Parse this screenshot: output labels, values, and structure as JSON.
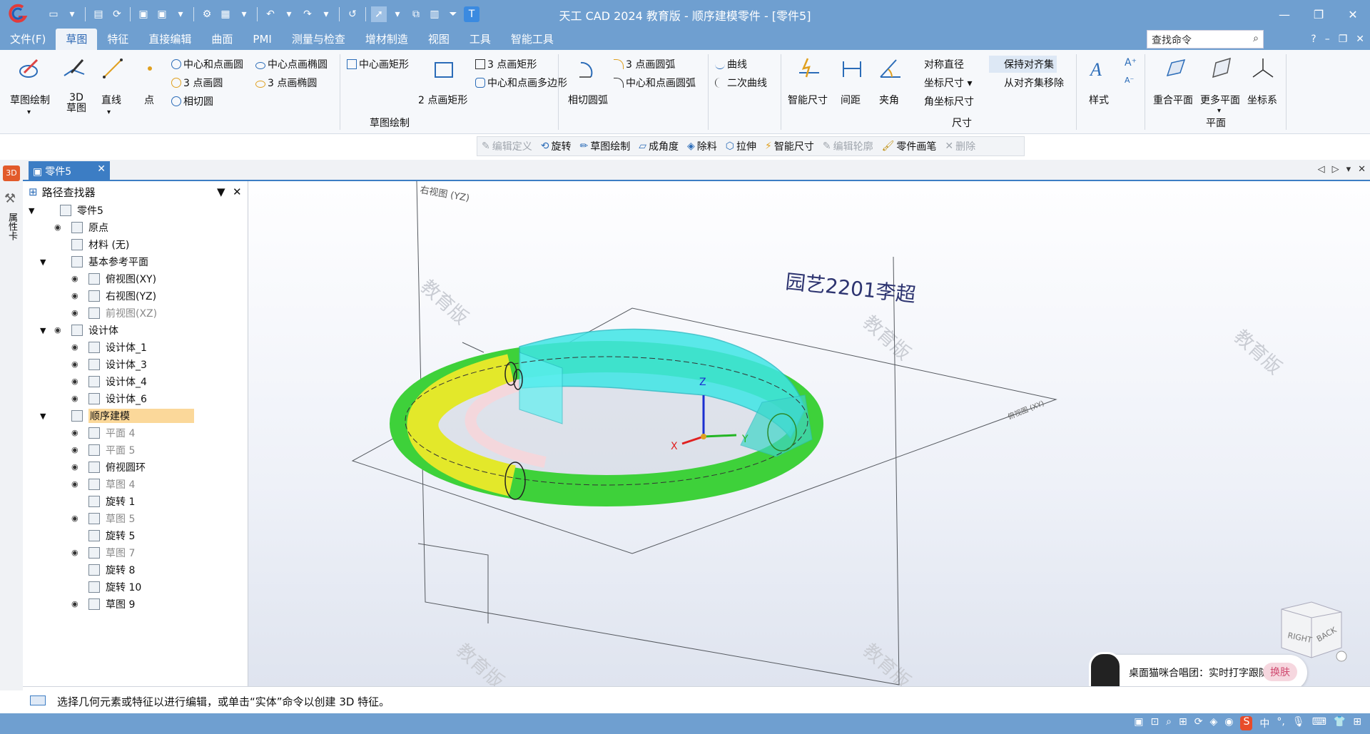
{
  "window": {
    "title": "天工 CAD 2024 教育版 - 顺序建模零件 - [零件5]"
  },
  "menubar": {
    "items": [
      "文件(F)",
      "草图",
      "特征",
      "直接编辑",
      "曲面",
      "PMI",
      "测量与检查",
      "增材制造",
      "视图",
      "工具",
      "智能工具"
    ],
    "search_placeholder": "查找命令"
  },
  "ribbon": {
    "sketch_draw": "草图绘制",
    "sketch_3d": "3D\n草图",
    "line": "直线",
    "point": "点",
    "circle_center": "中心和点画圆",
    "circle_3pt": "3 点画圆",
    "circle_tangent": "相切圆",
    "ellipse_center": "中心点画椭圆",
    "ellipse_3pt": "3 点画椭圆",
    "rect_center": "中心画矩形",
    "rect_2pt": "2 点画矩形",
    "rect_3pt": "3 点画矩形",
    "polygon": "中心和点画多边形",
    "tangent_arc": "相切圆弧",
    "arc_3pt": "3 点画圆弧",
    "arc_center": "中心和点画圆弧",
    "curve": "曲线",
    "conic": "二次曲线",
    "group_sketch": "草图绘制",
    "smart_dim": "智能尺寸",
    "spacing": "间距",
    "angle": "夹角",
    "sym_diameter": "对称直径",
    "coord_dim": "坐标尺寸",
    "angle_coord": "角坐标尺寸",
    "keep_align": "保持对齐集",
    "remove_align": "从对齐集移除",
    "group_dim": "尺寸",
    "style": "样式",
    "coincident_plane": "重合平面",
    "more_planes": "更多平面",
    "coord_sys": "坐标系",
    "group_plane": "平面"
  },
  "featurebar": {
    "items": [
      {
        "label": "编辑定义",
        "disabled": true
      },
      {
        "label": "旋转",
        "disabled": false
      },
      {
        "label": "草图绘制",
        "disabled": false
      },
      {
        "label": "成角度",
        "disabled": false
      },
      {
        "label": "除料",
        "disabled": false
      },
      {
        "label": "拉伸",
        "disabled": false
      },
      {
        "label": "智能尺寸",
        "disabled": false
      },
      {
        "label": "编辑轮廓",
        "disabled": true
      },
      {
        "label": "零件画笔",
        "disabled": false
      },
      {
        "label": "删除",
        "disabled": true
      }
    ]
  },
  "lefticons": {
    "badge": "3D",
    "props": "属性卡"
  },
  "tab": {
    "label": "零件5"
  },
  "pathfinder": {
    "title": "路径查找器",
    "rows": [
      {
        "label": "零件5",
        "level": 0,
        "expand": true,
        "eye": false,
        "gray": false
      },
      {
        "label": "原点",
        "level": 1,
        "expand": false,
        "eye": true,
        "gray": false
      },
      {
        "label": "材料 (无)",
        "level": 1,
        "expand": false,
        "eye": false,
        "gray": false
      },
      {
        "label": "基本参考平面",
        "level": 1,
        "expand": true,
        "eye": false,
        "gray": false
      },
      {
        "label": "俯视图(XY)",
        "level": 2,
        "expand": false,
        "eye": true,
        "gray": false
      },
      {
        "label": "右视图(YZ)",
        "level": 2,
        "expand": false,
        "eye": true,
        "gray": false
      },
      {
        "label": "前视图(XZ)",
        "level": 2,
        "expand": false,
        "eye": true,
        "gray": true
      },
      {
        "label": "设计体",
        "level": 1,
        "expand": true,
        "eye": true,
        "gray": false
      },
      {
        "label": "设计体_1",
        "level": 2,
        "expand": false,
        "eye": true,
        "gray": false
      },
      {
        "label": "设计体_3",
        "level": 2,
        "expand": false,
        "eye": true,
        "gray": false
      },
      {
        "label": "设计体_4",
        "level": 2,
        "expand": false,
        "eye": true,
        "gray": false
      },
      {
        "label": "设计体_6",
        "level": 2,
        "expand": false,
        "eye": true,
        "gray": false
      },
      {
        "label": "顺序建模",
        "level": 1,
        "expand": true,
        "eye": false,
        "gray": false,
        "highlight": true
      },
      {
        "label": "平面 4",
        "level": 2,
        "expand": false,
        "eye": true,
        "gray": true
      },
      {
        "label": "平面 5",
        "level": 2,
        "expand": false,
        "eye": true,
        "gray": true
      },
      {
        "label": "俯视圆环",
        "level": 2,
        "expand": false,
        "eye": true,
        "gray": false
      },
      {
        "label": "草图 4",
        "level": 2,
        "expand": false,
        "eye": true,
        "gray": true
      },
      {
        "label": "旋转 1",
        "level": 2,
        "expand": false,
        "eye": false,
        "gray": false
      },
      {
        "label": "草图 5",
        "level": 2,
        "expand": false,
        "eye": true,
        "gray": true
      },
      {
        "label": "旋转 5",
        "level": 2,
        "expand": false,
        "eye": false,
        "gray": false
      },
      {
        "label": "草图 7",
        "level": 2,
        "expand": false,
        "eye": true,
        "gray": true
      },
      {
        "label": "旋转 8",
        "level": 2,
        "expand": false,
        "eye": false,
        "gray": false
      },
      {
        "label": "旋转 10",
        "level": 2,
        "expand": false,
        "eye": false,
        "gray": false
      },
      {
        "label": "草图 9",
        "level": 2,
        "expand": false,
        "eye": true,
        "gray": false
      }
    ]
  },
  "viewport": {
    "plane_label": "右视图 (YZ)",
    "plane_label2": "俯视图 (XY)",
    "annotation": "园艺2201李超",
    "watermark": "教育版",
    "axis_x": "X",
    "axis_y": "Y",
    "axis_z": "Z",
    "cube_right": "RIGHT",
    "cube_back": "BACK"
  },
  "statusbar": {
    "text": "选择几何元素或特征以进行编辑，或单击“实体”命令以创建 3D 特征。"
  },
  "notify": {
    "text": "桌面猫咪合唱团：实时打字跟随",
    "button": "换肤"
  },
  "tray": {
    "ime": "中",
    "punct": "°,"
  }
}
